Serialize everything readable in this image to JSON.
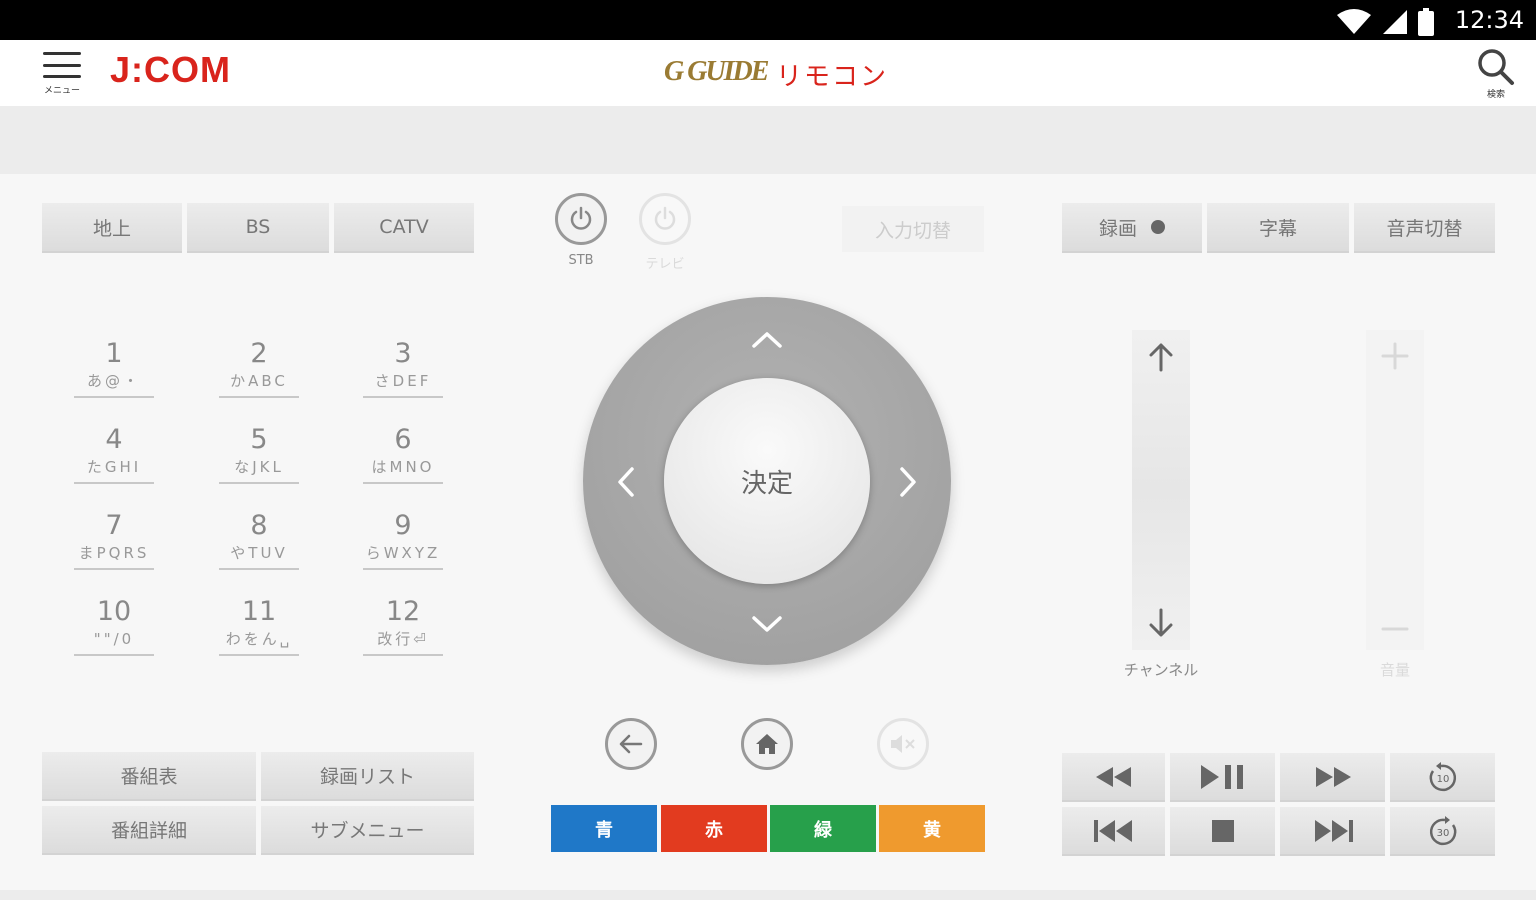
{
  "status_bar": {
    "time": "12:34",
    "wifi_icon": "wifi-icon",
    "signal_icon": "signal-icon",
    "battery_icon": "battery-icon"
  },
  "header": {
    "menu_label": "メニュー",
    "logo": "J:COM",
    "gguide_logo": "G GUIDE",
    "title": "リモコン",
    "search_label": "検索"
  },
  "tuner": {
    "terrestrial": "地上",
    "bs": "BS",
    "catv": "CATV"
  },
  "power": {
    "stb_label": "STB",
    "tv_label": "テレビ"
  },
  "input_switch": "入力切替",
  "record_group": {
    "record": "録画",
    "subtitle": "字幕",
    "audio_switch": "音声切替"
  },
  "numpad": [
    {
      "num": "1",
      "kana": "あ@・"
    },
    {
      "num": "2",
      "kana": "かABC"
    },
    {
      "num": "3",
      "kana": "さDEF"
    },
    {
      "num": "4",
      "kana": "たGHI"
    },
    {
      "num": "5",
      "kana": "なJKL"
    },
    {
      "num": "6",
      "kana": "はMNO"
    },
    {
      "num": "7",
      "kana": "まPQRS"
    },
    {
      "num": "8",
      "kana": "やTUV"
    },
    {
      "num": "9",
      "kana": "らWXYZ"
    },
    {
      "num": "10",
      "kana": "\"\"/0"
    },
    {
      "num": "11",
      "kana": "わをん␣"
    },
    {
      "num": "12",
      "kana": "改行⏎"
    }
  ],
  "dpad": {
    "center_label": "決定"
  },
  "nav_buttons": {
    "back_icon": "back-arrow-icon",
    "home_icon": "home-icon",
    "mute_icon": "mute-icon"
  },
  "color_buttons": [
    {
      "label": "青",
      "color": "#1f78c8"
    },
    {
      "label": "赤",
      "color": "#e23b1f"
    },
    {
      "label": "緑",
      "color": "#27a04b"
    },
    {
      "label": "黄",
      "color": "#ef9a2e"
    }
  ],
  "channel_label": "チャンネル",
  "volume_label": "音量",
  "menu_buttons": {
    "program_guide": "番組表",
    "recording_list": "録画リスト",
    "program_details": "番組詳細",
    "sub_menu": "サブメニュー"
  },
  "colors": {
    "brand_red": "#d9241c",
    "gguide_gold": "#9a7b33"
  }
}
